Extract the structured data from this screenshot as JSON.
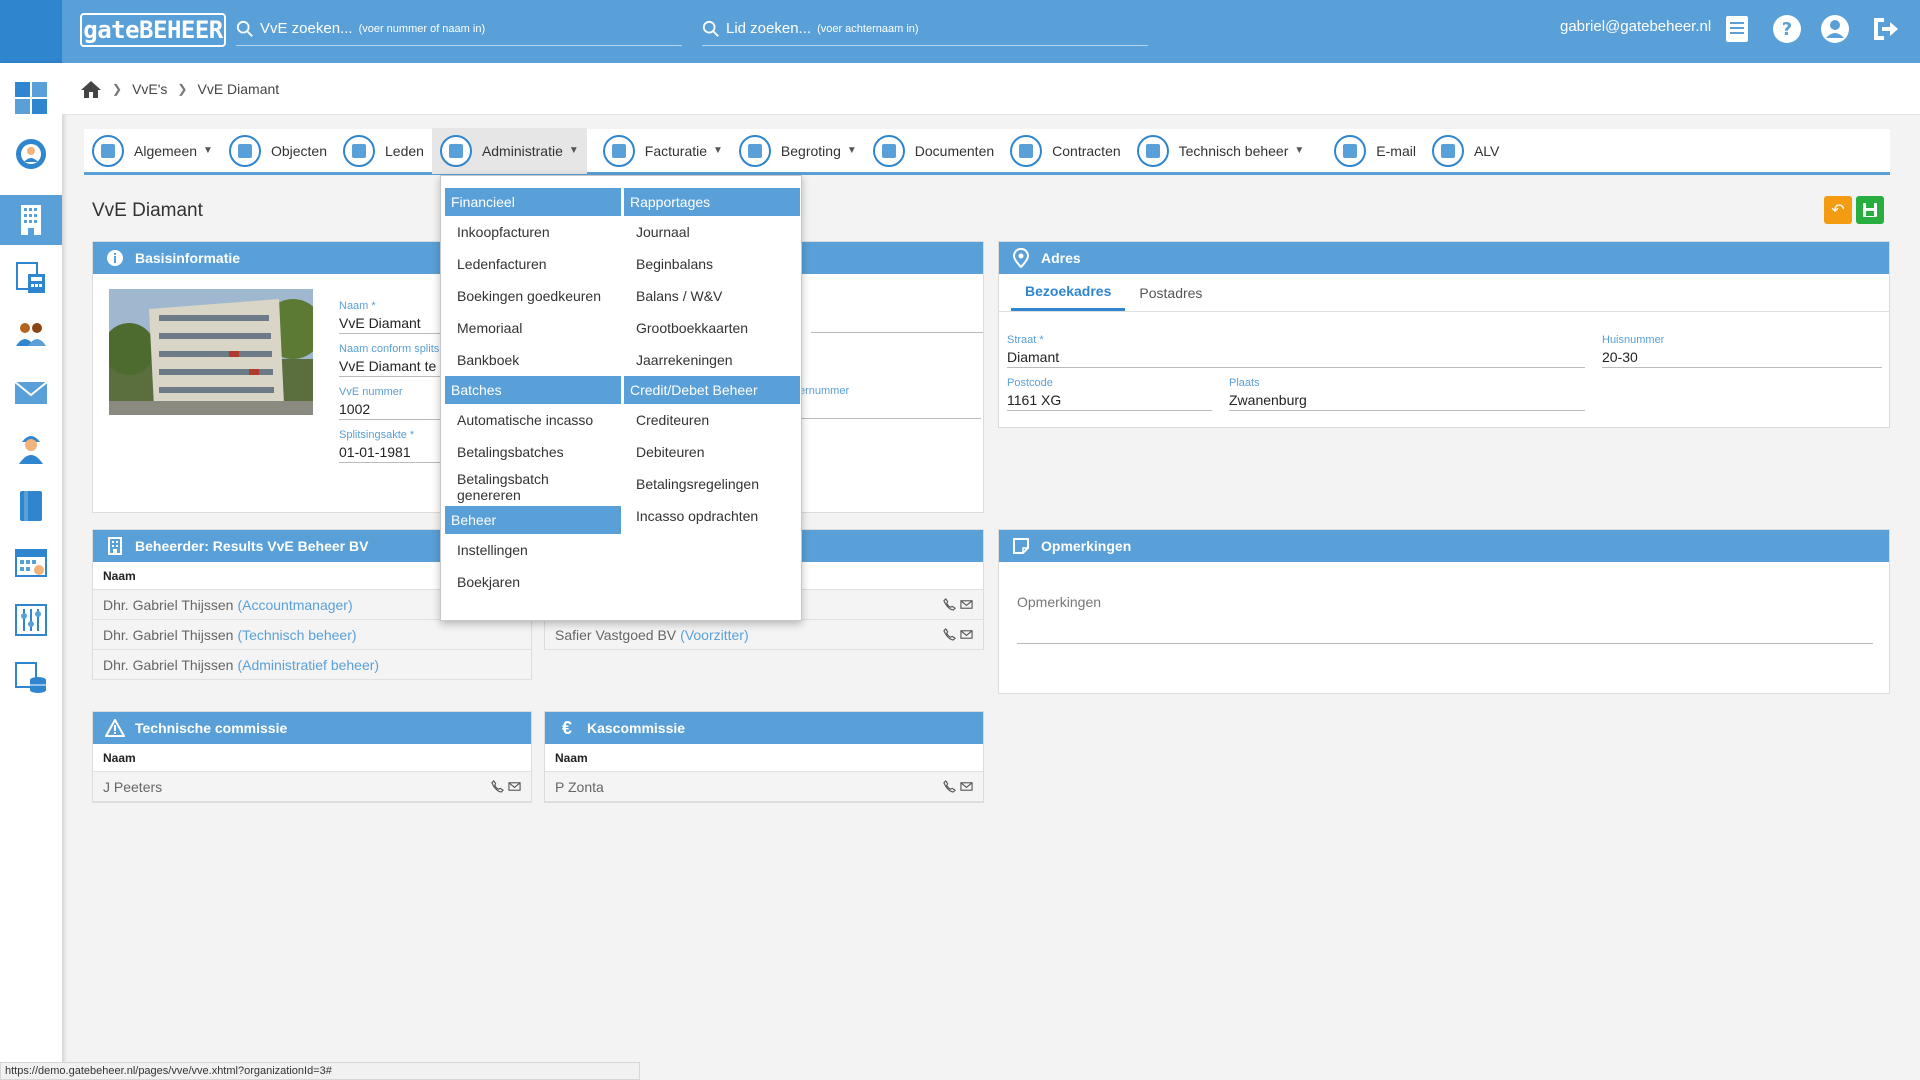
{
  "topbar": {
    "logo": "gateBEHEER",
    "search_vve": {
      "label": "VvE zoeken...",
      "hint": "(voer nummer of naam in)"
    },
    "search_lid": {
      "label": "Lid zoeken...",
      "hint": "(voer achternaam in)"
    },
    "user_email": "gabriel@gatebeheer.nl"
  },
  "breadcrumb": {
    "items": [
      "VvE's",
      "VvE Diamant"
    ]
  },
  "nav": {
    "items": [
      {
        "label": "Algemeen"
      },
      {
        "label": "Objecten"
      },
      {
        "label": "Leden"
      },
      {
        "label": "Administratie"
      },
      {
        "label": "Facturatie"
      },
      {
        "label": "Begroting"
      },
      {
        "label": "Documenten"
      },
      {
        "label": "Contracten"
      },
      {
        "label": "Technisch beheer"
      },
      {
        "label": "E-mail"
      },
      {
        "label": "ALV"
      }
    ]
  },
  "dropdown": {
    "col1": {
      "sections": [
        {
          "title": "Financieel",
          "items": [
            "Inkoopfacturen",
            "Ledenfacturen",
            "Boekingen goedkeuren",
            "Memoriaal",
            "Bankboek"
          ]
        },
        {
          "title": "Batches",
          "items": [
            "Automatische incasso",
            "Betalingsbatches",
            "Betalingsbatch genereren"
          ]
        },
        {
          "title": "Beheer",
          "items": [
            "Instellingen",
            "Boekjaren"
          ]
        }
      ]
    },
    "col2": {
      "sections": [
        {
          "title": "Rapportages",
          "items": [
            "Journaal",
            "Beginbalans",
            "Balans / W&V",
            "Grootboekkaarten",
            "Jaarrekeningen"
          ]
        },
        {
          "title": "Credit/Debet Beheer",
          "items": [
            "Crediteuren",
            "Debiteuren",
            "Betalingsregelingen",
            "Incasso opdrachten"
          ]
        }
      ]
    }
  },
  "page": {
    "title": "VvE Diamant"
  },
  "basis": {
    "title": "Basisinformatie",
    "naam_label": "Naam *",
    "naam": "VvE Diamant",
    "naam_splits_label": "Naam conform splits",
    "naam_splits": "VvE Diamant te Z",
    "nummer_label": "VvE nummer",
    "nummer": "1002",
    "splitsingsakte_label": "Splitsingsakte *",
    "splitsingsakte": "01-01-1981",
    "hidden_label_suffix": "ernummer"
  },
  "adres": {
    "title": "Adres",
    "tab_bezoek": "Bezoekadres",
    "tab_post": "Postadres",
    "straat_label": "Straat *",
    "straat": "Diamant",
    "huisnummer_label": "Huisnummer",
    "huisnummer": "20-30",
    "postcode_label": "Postcode",
    "postcode": "1161 XG",
    "plaats_label": "Plaats",
    "plaats": "Zwanenburg"
  },
  "beheerder": {
    "title": "Beheerder: Results VvE Beheer BV",
    "col_naam": "Naam",
    "rows": [
      {
        "name": "Dhr. Gabriel Thijssen",
        "role": "(Accountmanager)"
      },
      {
        "name": "Dhr. Gabriel Thijssen",
        "role": "(Technisch beheer)"
      },
      {
        "name": "Dhr. Gabriel Thijssen",
        "role": "(Administratief beheer)"
      }
    ]
  },
  "bestuur": {
    "rows": [
      {
        "name": "Safier Vastgoed BV",
        "role": "(Voorzitter)"
      }
    ]
  },
  "opmerkingen": {
    "title": "Opmerkingen",
    "placeholder": "Opmerkingen"
  },
  "technische": {
    "title": "Technische commissie",
    "col_naam": "Naam",
    "rows": [
      {
        "name": "J Peeters"
      }
    ]
  },
  "kas": {
    "title": "Kascommissie",
    "col_naam": "Naam",
    "rows": [
      {
        "name": "P Zonta"
      }
    ]
  },
  "status": {
    "url": "https://demo.gatebeheer.nl/pages/vve/vve.xhtml?organizationId=3#"
  },
  "colors": {
    "primary": "#5aa0d8",
    "dark": "#2f86cf",
    "undo": "#f39c12",
    "save": "#27ae3e"
  }
}
